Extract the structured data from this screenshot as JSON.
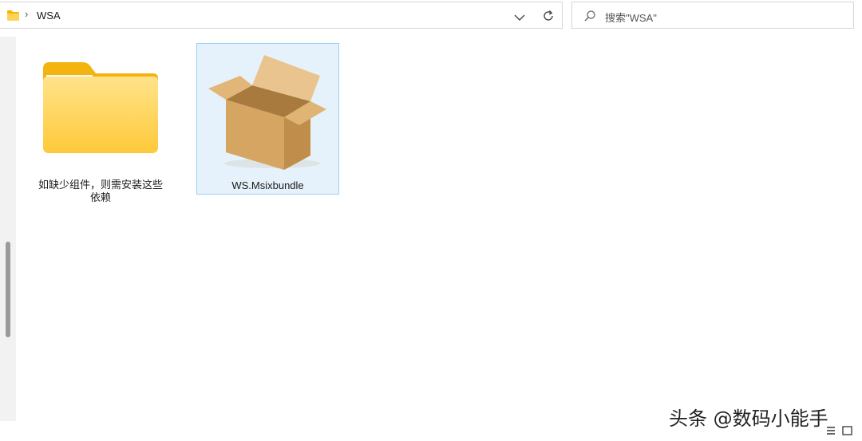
{
  "address_bar": {
    "separator": "›",
    "current_folder": "WSA"
  },
  "search": {
    "placeholder": "搜索\"WSA\""
  },
  "files": [
    {
      "name": "如缺少组件，则需安装这些依赖",
      "type": "folder-icon"
    },
    {
      "name": "WS.Msixbundle",
      "type": "package-box-icon",
      "selected": true
    }
  ],
  "watermark": {
    "text": "头条 @数码小能手"
  },
  "colors": {
    "accent_selection_bg": "#e6f2fb",
    "accent_selection_border": "#99d1f5",
    "folder_yellow": "#ffd35a"
  }
}
